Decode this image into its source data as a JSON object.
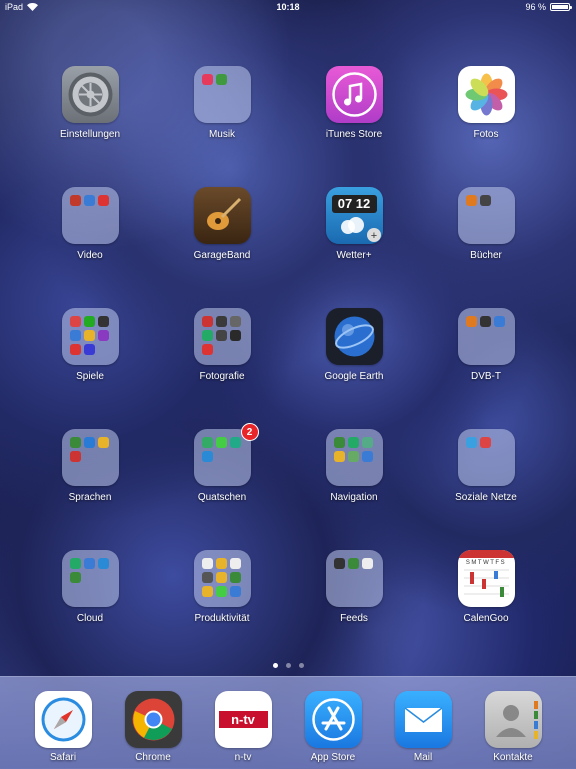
{
  "status_bar": {
    "carrier": "iPad",
    "time": "10:18",
    "battery_text": "96 %",
    "battery_level": 0.96
  },
  "home": {
    "apps": [
      {
        "label": "Einstellungen"
      },
      {
        "label": "Musik"
      },
      {
        "label": "iTunes Store"
      },
      {
        "label": "Fotos"
      },
      {
        "label": "Video"
      },
      {
        "label": "GarageBand"
      },
      {
        "label": "Wetter+",
        "clock": "07 12"
      },
      {
        "label": "Bücher"
      },
      {
        "label": "Spiele"
      },
      {
        "label": "Fotografie"
      },
      {
        "label": "Google Earth"
      },
      {
        "label": "DVB-T"
      },
      {
        "label": "Sprachen"
      },
      {
        "label": "Quatschen",
        "badge": "2"
      },
      {
        "label": "Navigation"
      },
      {
        "label": "Soziale Netze"
      },
      {
        "label": "Cloud"
      },
      {
        "label": "Produktivität"
      },
      {
        "label": "Feeds"
      },
      {
        "label": "CalenGoo",
        "weekdays": "SMTWTFS"
      }
    ]
  },
  "page_dots": {
    "count": 3,
    "active": 0
  },
  "dock": {
    "apps": [
      {
        "label": "Safari"
      },
      {
        "label": "Chrome"
      },
      {
        "label": "n-tv",
        "logo_text": "n-tv"
      },
      {
        "label": "App Store"
      },
      {
        "label": "Mail"
      },
      {
        "label": "Kontakte"
      }
    ]
  },
  "colors": {
    "badge": "#e8262a",
    "itunes": "#d63fc0",
    "appstore": "#1a8cf0",
    "mail": "#2a9cf5"
  }
}
